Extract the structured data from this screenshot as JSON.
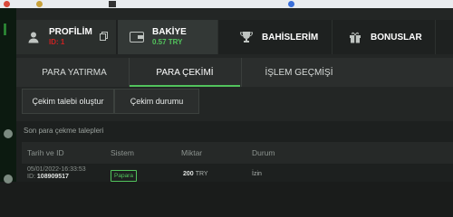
{
  "tabs": {
    "profile": {
      "label": "PROFİLİM",
      "sub": "ID: 1"
    },
    "balance": {
      "label": "BAKİYE",
      "sub": "0.57 TRY"
    },
    "bets": {
      "label": "BAHİSLERİM"
    },
    "bonus": {
      "label": "BONUSLAR"
    }
  },
  "subtabs": [
    "PARA YATIRMA",
    "PARA ÇEKİMİ",
    "İŞLEM GEÇMİŞİ"
  ],
  "active_subtab": "PARA ÇEKİMİ",
  "pills": [
    "Çekim talebi oluştur",
    "Çekim durumu"
  ],
  "section": {
    "title": "Son para çekme talepleri",
    "columns": [
      "Tarih ve ID",
      "Sistem",
      "Miktar",
      "Durum"
    ],
    "rows": [
      {
        "date": "05/01/2022-16:33:53",
        "id_prefix": "ID:",
        "id": "108909517",
        "system": "Papara",
        "amount": "200",
        "currency": "TRY",
        "status": "İzin"
      }
    ]
  },
  "colors": {
    "accent": "#52c35c",
    "red": "#cc2222"
  },
  "icons": {
    "profile": "user-icon",
    "balance": "wallet-icon",
    "bets": "trophy-icon",
    "bonus": "gift-icon"
  }
}
